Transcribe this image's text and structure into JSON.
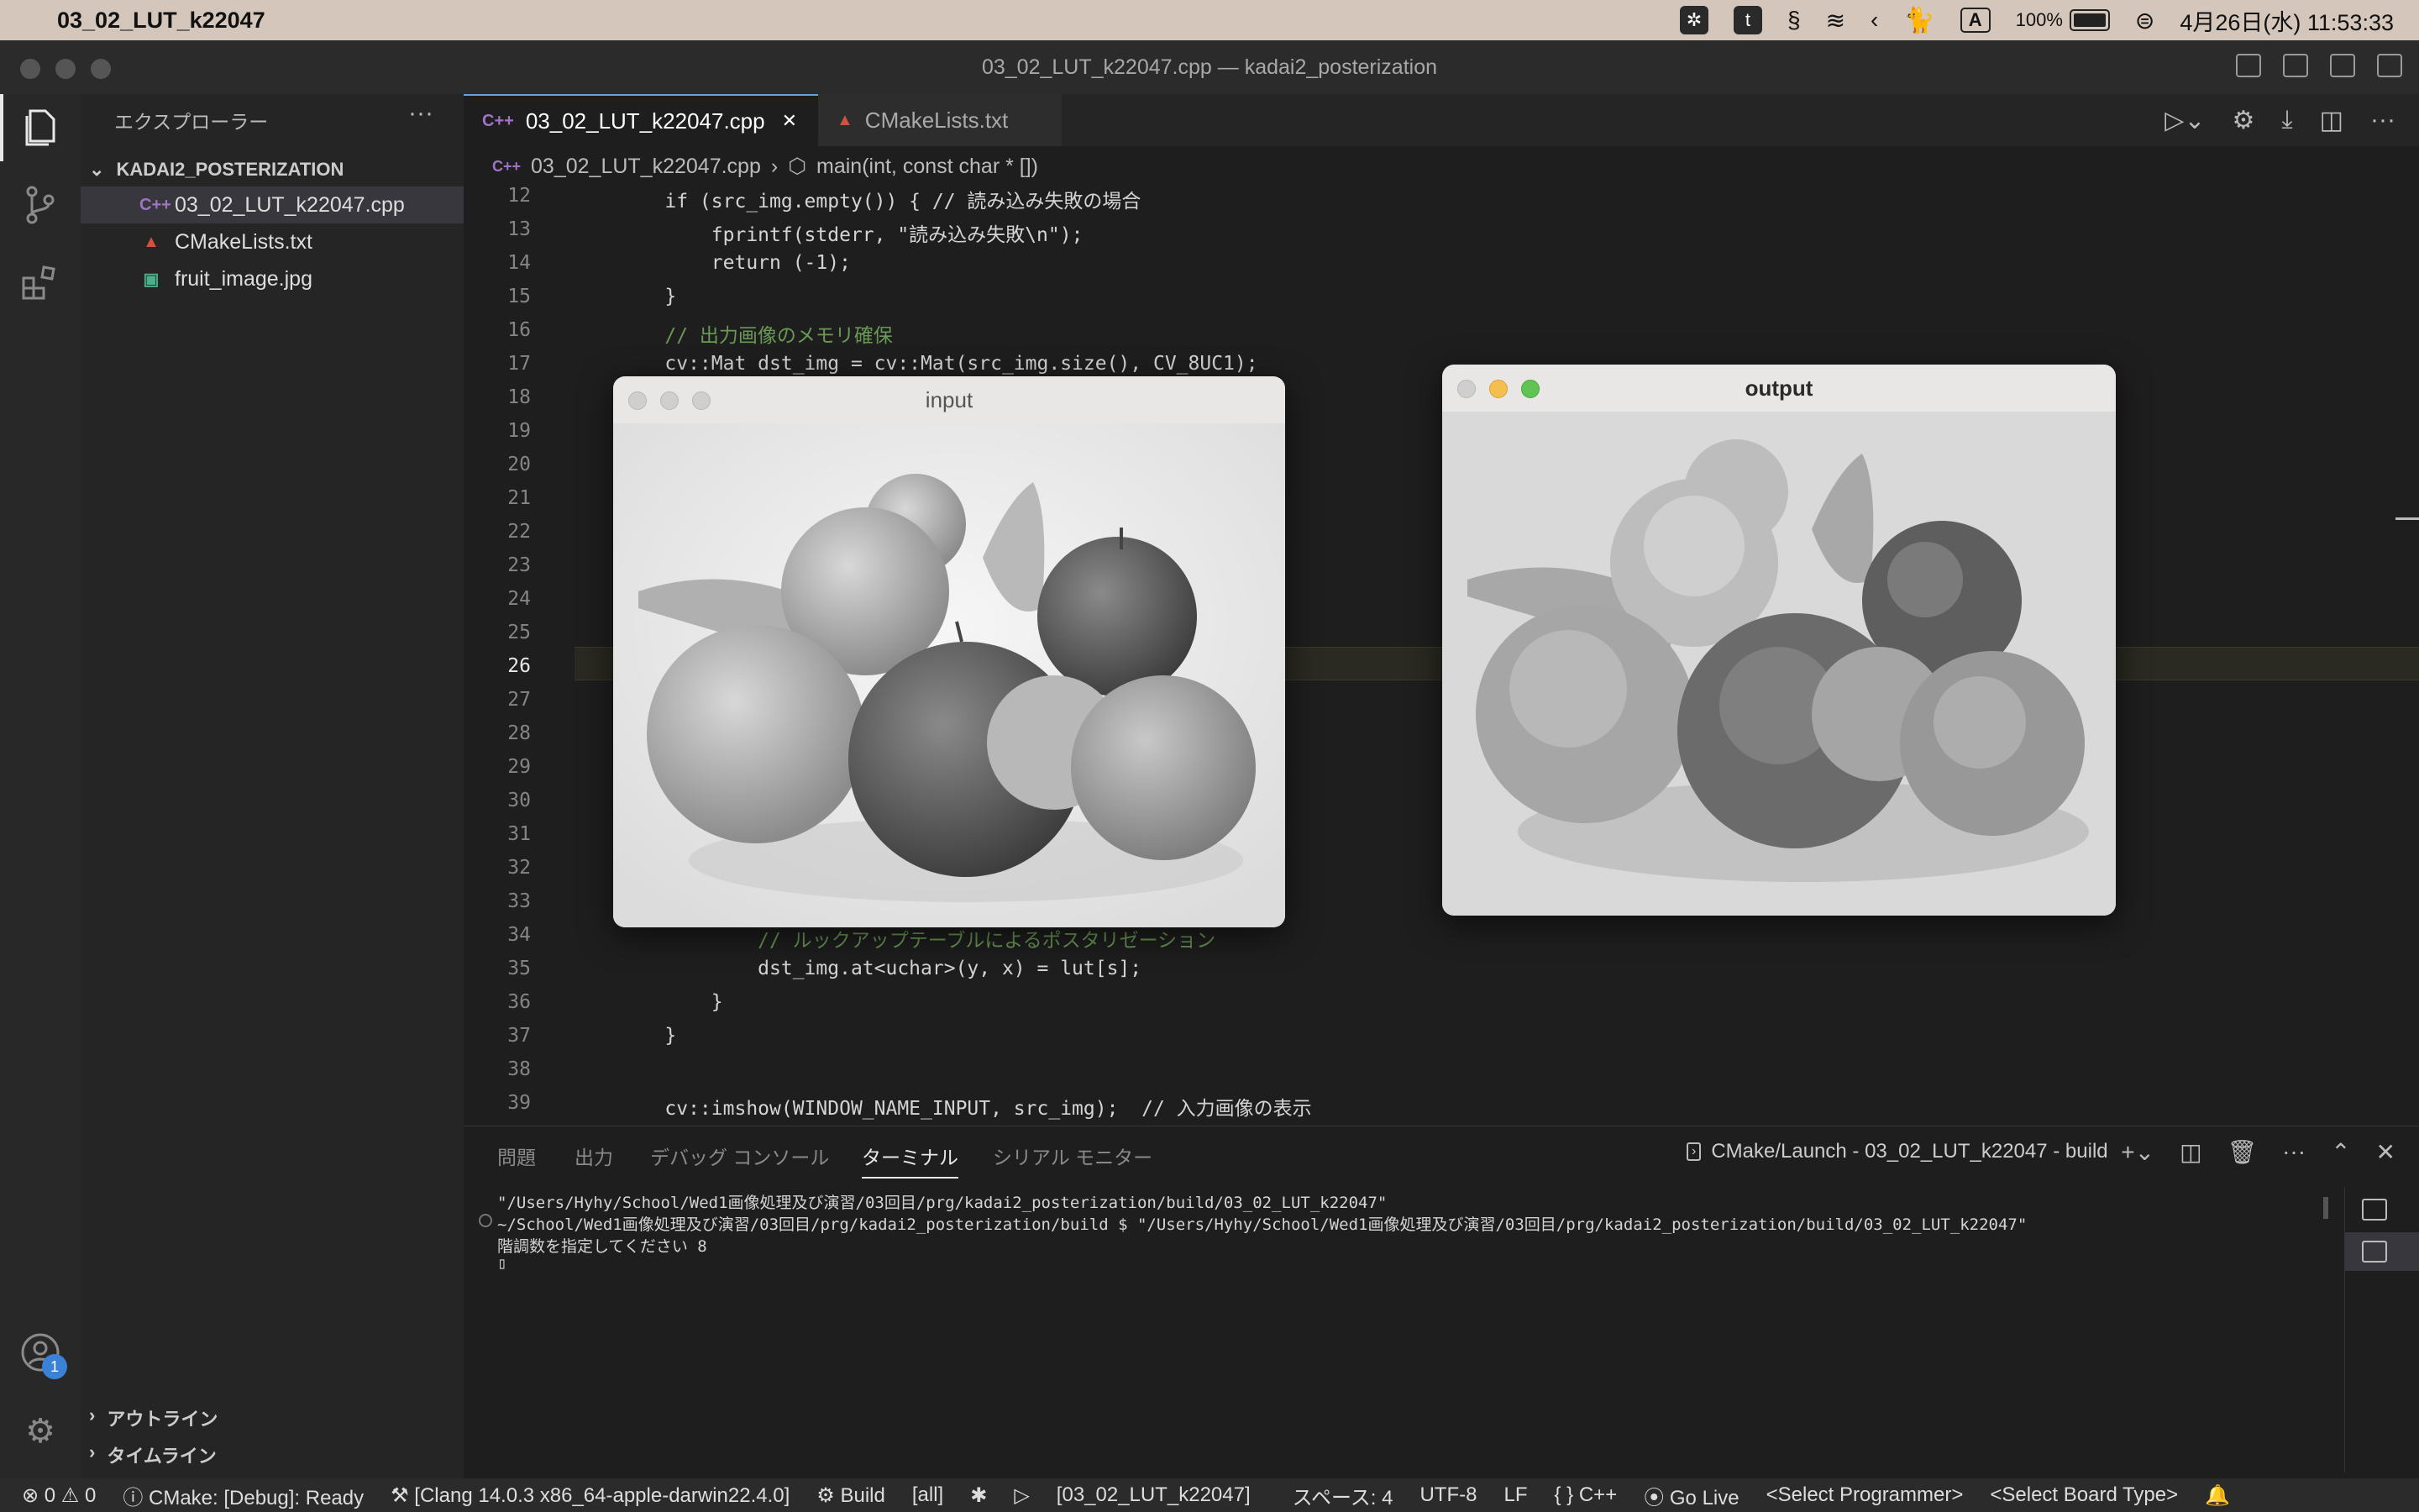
{
  "menubar": {
    "app_name": "03_02_LUT_k22047",
    "battery": "100%",
    "input_mode": "A",
    "datetime": "4月26日(水) 11:53:33"
  },
  "window": {
    "title": "03_02_LUT_k22047.cpp — kadai2_posterization"
  },
  "activity": {
    "account_badge": "1"
  },
  "sidebar": {
    "title": "エクスプローラー",
    "more": "···",
    "folder": "KADAI2_POSTERIZATION",
    "files": [
      {
        "icon": "C++",
        "name": "03_02_LUT_k22047.cpp"
      },
      {
        "icon": "▲",
        "name": "CMakeLists.txt"
      },
      {
        "icon": "▣",
        "name": "fruit_image.jpg"
      }
    ],
    "outline": "アウトライン",
    "timeline": "タイムライン"
  },
  "tabs": [
    {
      "icon": "C++",
      "label": "03_02_LUT_k22047.cpp",
      "close": "✕"
    },
    {
      "icon": "▲",
      "label": "CMakeLists.txt"
    }
  ],
  "breadcrumb": {
    "file": "03_02_LUT_k22047.cpp",
    "symbol": "main(int, const char * [])"
  },
  "code": {
    "lines": [
      {
        "n": "12",
        "t": "    if (src_img.empty()) { // 読み込み失敗の場合"
      },
      {
        "n": "13",
        "t": "        fprintf(stderr, \"読み込み失敗\\n\");"
      },
      {
        "n": "14",
        "t": "        return (-1);"
      },
      {
        "n": "15",
        "t": "    }"
      },
      {
        "n": "16",
        "t": "    // 出力画像のメモリ確保"
      },
      {
        "n": "17",
        "t": "    cv::Mat dst_img = cv::Mat(src_img.size(), CV_8UC1);"
      },
      {
        "n": "18",
        "t": ""
      },
      {
        "n": "19",
        "t": ""
      },
      {
        "n": "20",
        "t": ""
      },
      {
        "n": "21",
        "t": ""
      },
      {
        "n": "22",
        "t": ""
      },
      {
        "n": "23",
        "t": ""
      },
      {
        "n": "24",
        "t": ""
      },
      {
        "n": "25",
        "t": ""
      },
      {
        "n": "26",
        "t": ""
      },
      {
        "n": "27",
        "t": ""
      },
      {
        "n": "28",
        "t": ""
      },
      {
        "n": "29",
        "t": ""
      },
      {
        "n": "30",
        "t": ""
      },
      {
        "n": "31",
        "t": ""
      },
      {
        "n": "32",
        "t": ""
      },
      {
        "n": "33",
        "t": ""
      },
      {
        "n": "34",
        "t": "            // ルックアップテーブルによるポスタリゼーション"
      },
      {
        "n": "35",
        "t": "            dst_img.at<uchar>(y, x) = lut[s];"
      },
      {
        "n": "36",
        "t": "        }"
      },
      {
        "n": "37",
        "t": "    }"
      },
      {
        "n": "38",
        "t": ""
      },
      {
        "n": "39",
        "t": "    cv::imshow(WINDOW_NAME_INPUT, src_img);  // 入力画像の表示"
      }
    ]
  },
  "panel": {
    "tabs": [
      "問題",
      "出力",
      "デバッグ コンソール",
      "ターミナル",
      "シリアル モニター"
    ],
    "terminal_name": "CMake/Launch - 03_02_LUT_k22047 - build",
    "lines": [
      "\"/Users/Hyhy/School/Wed1画像処理及び演習/03回目/prg/kadai2_posterization/build/03_02_LUT_k22047\"",
      "~/School/Wed1画像処理及び演習/03回目/prg/kadai2_posterization/build $ \"/Users/Hyhy/School/Wed1画像処理及び演習/03回目/prg/kadai2_posterization/build/03_02_LUT_k22047\"",
      "階調数を指定してください 8",
      "▯"
    ]
  },
  "statusbar": {
    "errors": "⊗ 0 ⚠ 0",
    "cmake": "ⓘ CMake: [Debug]: Ready",
    "kit": "⚒ [Clang 14.0.3 x86_64-apple-darwin22.4.0]",
    "build": "⚙ Build",
    "target": "[all]",
    "launch_target": "[03_02_LUT_k22047]",
    "spaces": "スペース: 4",
    "encoding": "UTF-8",
    "eol": "LF",
    "language": "{ } C++",
    "golive": "Go Live",
    "programmer": "<Select Programmer>",
    "board": "<Select Board Type>"
  },
  "cv_windows": {
    "input_title": "input",
    "output_title": "output"
  },
  "colors": {
    "keyword": "#c586c0",
    "function": "#dcdcaa",
    "string": "#ce9178",
    "comment": "#6a9955",
    "namespace": "#4ec9b0",
    "accent": "#3b82d6"
  }
}
